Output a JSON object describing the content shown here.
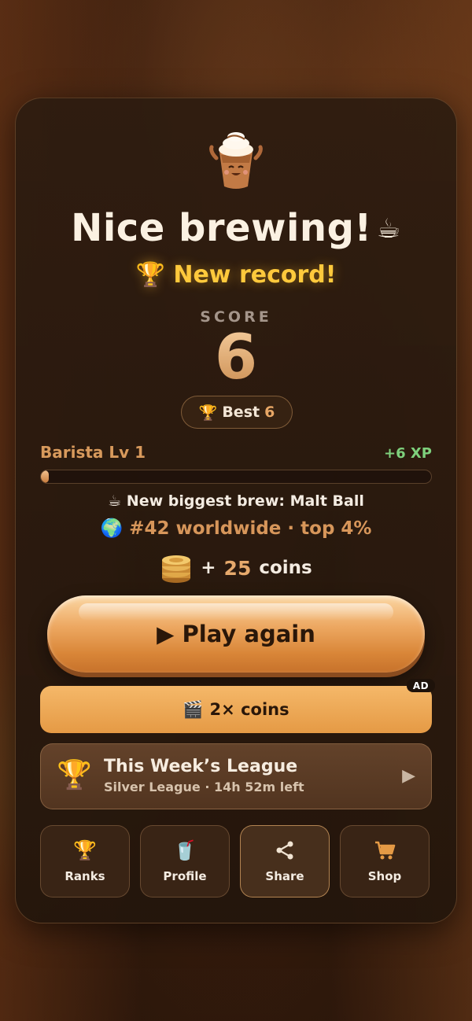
{
  "title": "Nice brewing!",
  "title_icon": "☕",
  "record_icon": "🏆",
  "record_text": "New record!",
  "score": {
    "label": "SCORE",
    "value": "6"
  },
  "best": {
    "icon": "🏆",
    "label": "Best",
    "value": "6"
  },
  "level": {
    "label": "Barista Lv 1",
    "xp_gain": "+6 XP",
    "progress": 0.02
  },
  "brew": {
    "icon": "☕",
    "text": "New biggest brew: Malt Ball"
  },
  "rank": {
    "icon": "🌍",
    "text": "#42 worldwide · top 4%"
  },
  "coins": {
    "plus": "+",
    "amount": "25",
    "label": "coins"
  },
  "play_button": {
    "label": "▶ Play again"
  },
  "double_coins": {
    "icon": "🎬",
    "label": "2× coins",
    "badge": "AD"
  },
  "league": {
    "icon": "🏆",
    "title": "This Week’s League",
    "subtitle": "Silver League · 14h 52m left",
    "arrow": "▶"
  },
  "nav": [
    {
      "icon": "🏆",
      "label": "Ranks"
    },
    {
      "icon": "🥤",
      "label": "Profile"
    },
    {
      "icon": "share-icon",
      "label": "Share"
    },
    {
      "icon": "cart-icon",
      "label": "Shop"
    }
  ],
  "colors": {
    "accent": "#e59a45",
    "record": "#ffc93c",
    "xp": "#7ed07c",
    "card": "#2d1c10"
  }
}
